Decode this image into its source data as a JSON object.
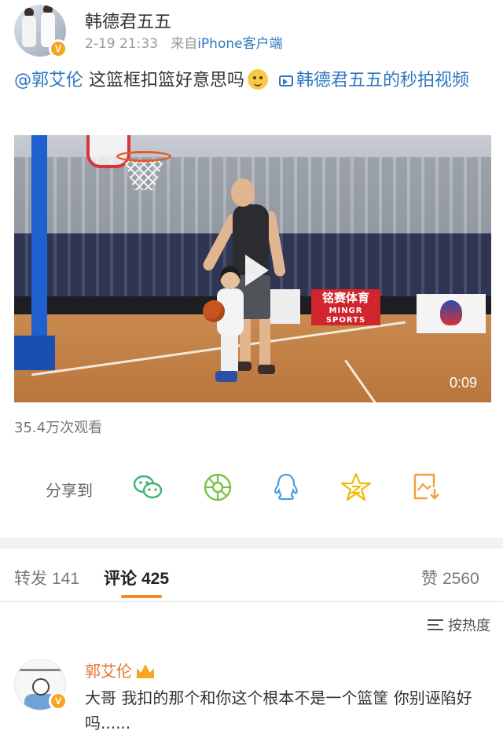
{
  "post": {
    "username": "韩德君五五",
    "time": "2-19 21:33",
    "source_prefix": "来自",
    "source": "iPhone客户端",
    "mention": "@郭艾伦",
    "text": " 这篮框扣篮好意思吗",
    "video_link": "韩德君五五的秒拍视频",
    "video": {
      "duration": "0:09",
      "adboard_text": "铭赛体育",
      "adboard_sub": "MINGR SPORTS"
    },
    "views": "35.4万次观看"
  },
  "share": {
    "label": "分享到",
    "icons": [
      "wechat-icon",
      "moments-icon",
      "qq-icon",
      "qzone-icon",
      "save-image-icon"
    ]
  },
  "tabs": [
    {
      "label": "转发",
      "count": "141"
    },
    {
      "label": "评论",
      "count": "425"
    },
    {
      "label": "赞",
      "count": "2560"
    }
  ],
  "sort_label": "按热度",
  "comment": {
    "name": "郭艾伦",
    "text": "大哥 我扣的那个和你这个根本不是一个篮筐 你别诬陷好吗......"
  },
  "colors": {
    "link": "#2e77c0",
    "accent": "#f28c1e",
    "comment_name": "#e2742a",
    "share_icon": "#3cb371"
  }
}
